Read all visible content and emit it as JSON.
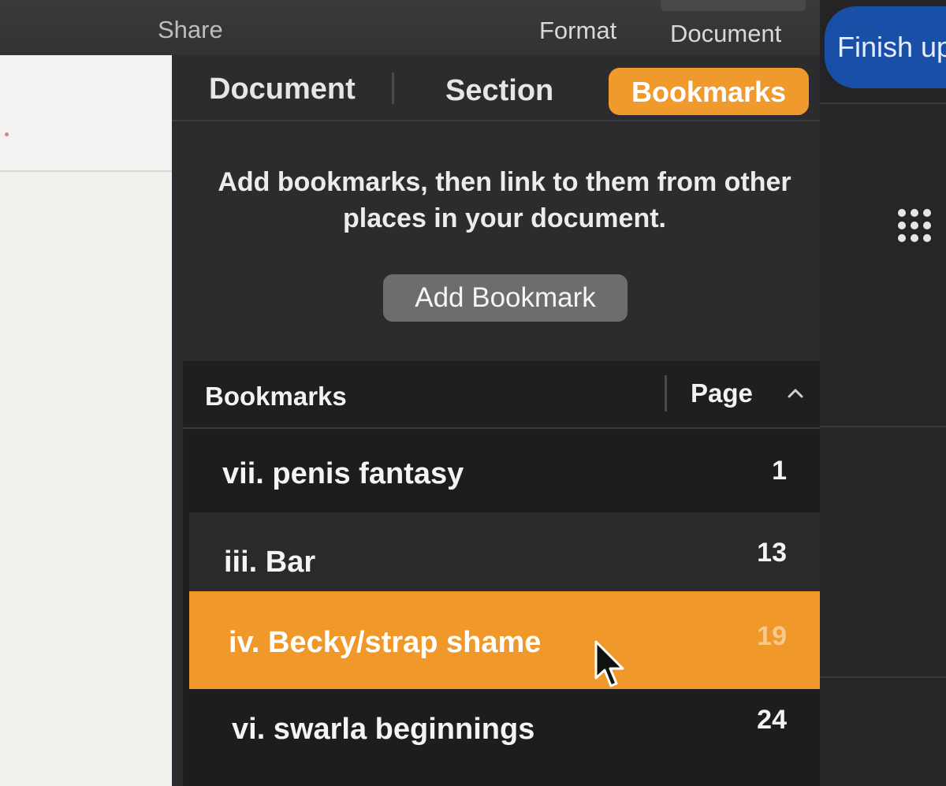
{
  "toolbar": {
    "share": "Share",
    "format": "Format",
    "document": "Document"
  },
  "finish_button": "Finish up",
  "tabs": {
    "document": "Document",
    "section": "Section",
    "bookmarks": "Bookmarks"
  },
  "info_text": "Add bookmarks, then link to them from other places in your document.",
  "add_bookmark_button": "Add Bookmark",
  "list_header": {
    "name": "Bookmarks",
    "page": "Page"
  },
  "bookmarks": [
    {
      "name": "vii. penis fantasy",
      "page": "1"
    },
    {
      "name": "iii. Bar",
      "page": "13"
    },
    {
      "name": "iv. Becky/strap shame",
      "page": "19"
    },
    {
      "name": "vi. swarla beginnings",
      "page": "24"
    }
  ],
  "colors": {
    "accent": "#f09a2d",
    "finish_blue": "#1a4fa8"
  },
  "icons": [
    "chevron-up-icon",
    "grid-dots-icon",
    "cursor-icon"
  ]
}
